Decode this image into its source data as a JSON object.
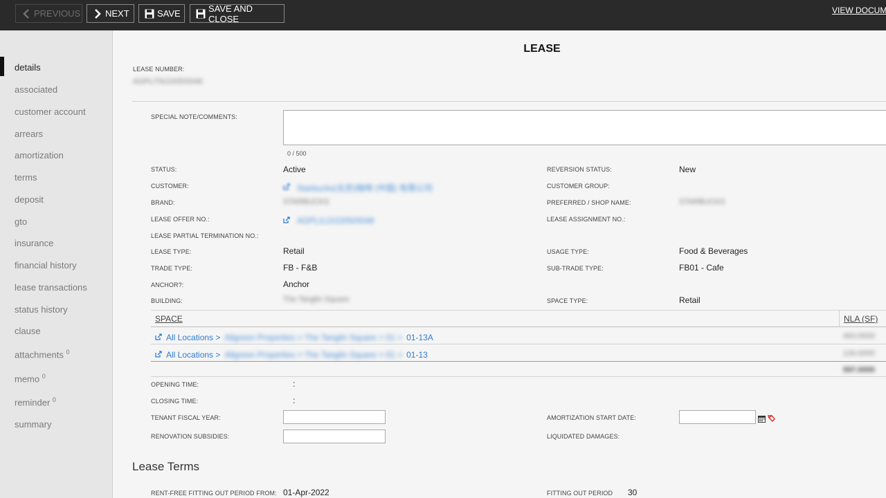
{
  "toolbar": {
    "previous_label": "PREVIOUS",
    "next_label": "NEXT",
    "save_label": "SAVE",
    "save_close_label": "SAVE AND CLOSE",
    "view_documents_label": "VIEW DOCUMEN"
  },
  "sidebar": {
    "items": [
      {
        "label": "details",
        "active": true
      },
      {
        "label": "associated"
      },
      {
        "label": "customer account"
      },
      {
        "label": "arrears"
      },
      {
        "label": "amortization"
      },
      {
        "label": "terms"
      },
      {
        "label": "deposit"
      },
      {
        "label": "gto"
      },
      {
        "label": "insurance"
      },
      {
        "label": "financial history"
      },
      {
        "label": "lease transactions"
      },
      {
        "label": "status history"
      },
      {
        "label": "clause"
      },
      {
        "label": "attachments",
        "count": "0"
      },
      {
        "label": "memo",
        "count": "0"
      },
      {
        "label": "reminder",
        "count": "0"
      },
      {
        "label": "summary"
      }
    ]
  },
  "form": {
    "title": "LEASE",
    "lease_number_label": "LEASE NUMBER:",
    "lease_number_value": "AGPL/TA/2205/0046",
    "special_note_label": "SPECIAL NOTE/COMMENTS:",
    "special_note_counter": "0 / 500",
    "status_label": "STATUS:",
    "status_value": "Active",
    "reversion_status_label": "REVERSION STATUS:",
    "reversion_status_value": "New",
    "customer_label": "CUSTOMER:",
    "customer_value": "Starbucks(北京)咖啡 (中国) 有限公司",
    "customer_group_label": "CUSTOMER GROUP:",
    "brand_label": "BRAND:",
    "brand_value": "STARBUCKS",
    "preferred_shop_label": "PREFERRED / SHOP NAME:",
    "preferred_shop_value": "STARBUCKS",
    "lease_offer_label": "LEASE OFFER NO.:",
    "lease_offer_value": "AGPL/LO/2205/0048",
    "lease_assignment_label": "LEASE ASSIGNMENT NO.:",
    "lease_partial_label": "LEASE PARTIAL TERMINATION NO.:",
    "lease_type_label": "LEASE TYPE:",
    "lease_type_value": "Retail",
    "usage_type_label": "USAGE TYPE:",
    "usage_type_value": "Food & Beverages",
    "trade_type_label": "TRADE TYPE:",
    "trade_type_value": "FB - F&B",
    "sub_trade_type_label": "SUB-TRADE TYPE:",
    "sub_trade_type_value": "FB01 - Cafe",
    "anchor_label": "ANCHOR?:",
    "anchor_value": "Anchor",
    "building_label": "BUILDING:",
    "building_value": "The Tanglin Square",
    "space_type_label": "SPACE TYPE:",
    "space_type_value": "Retail",
    "space_header": "SPACE",
    "nla_header": "NLA (SF)",
    "spaces": [
      {
        "prefix": "All Locations >",
        "path": "Allgreen Properties > The Tanglin Square > 01 >",
        "unit": "01-13A",
        "nla": "463.0000"
      },
      {
        "prefix": "All Locations >",
        "path": "Allgreen Properties > The Tanglin Square > 01 >",
        "unit": "01-13",
        "nla": "134.0000"
      }
    ],
    "nla_total": "597.0000",
    "opening_time_label": "OPENING TIME:",
    "opening_time_value": ":",
    "closing_time_label": "CLOSING TIME:",
    "closing_time_value": ":",
    "tenant_fiscal_label": "TENANT FISCAL YEAR:",
    "amortization_start_label": "AMORTIZATION START DATE:",
    "renovation_label": "RENOVATION SUBSIDIES:",
    "liquidated_label": "LIQUIDATED DAMAGES:",
    "lease_terms_heading": "Lease Terms",
    "rent_free_label": "RENT-FREE FITTING OUT PERIOD FROM:",
    "rent_free_value": "01-Apr-2022",
    "fitting_out_label": "FITTING OUT PERIOD",
    "fitting_out_value": "30"
  },
  "icons": {
    "previous": "chevron-left-icon",
    "next": "chevron-right-icon",
    "save": "floppy-disk-icon",
    "external_link": "external-link-icon",
    "calendar": "calendar-icon",
    "clear": "clear-eraser-icon"
  },
  "colors": {
    "topbar": "#2a2a2a",
    "link": "#2f7bd1",
    "sidebar": "#e6e6e6"
  }
}
